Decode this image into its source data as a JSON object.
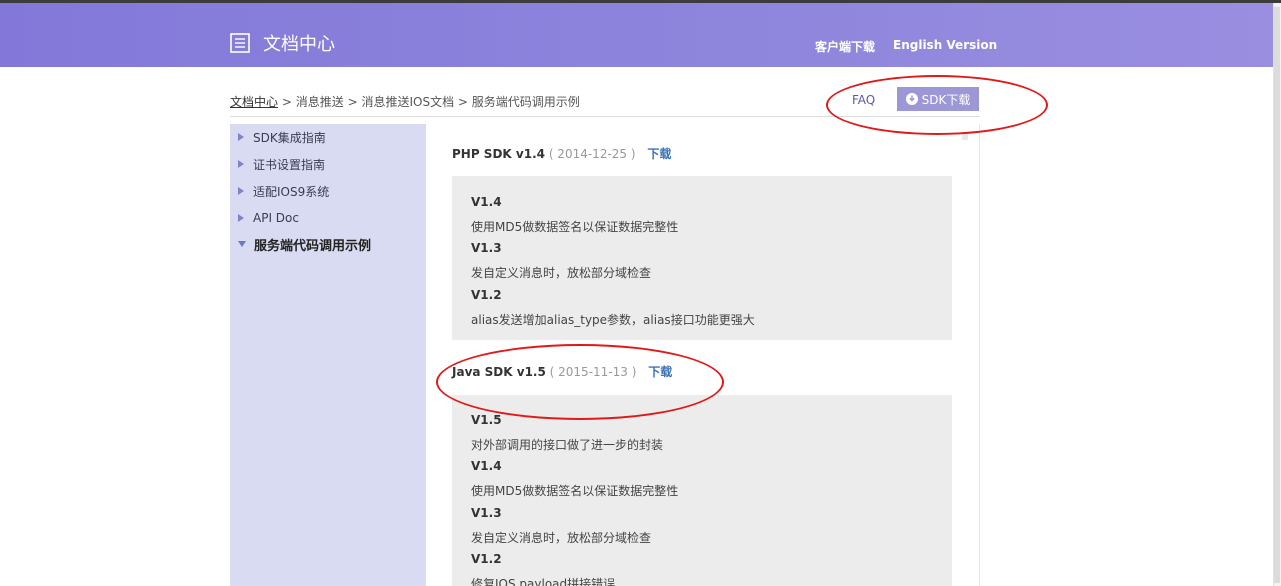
{
  "header": {
    "title": "文档中心",
    "logo_icon": "document-list-icon",
    "nav": {
      "client_download": "客户端下载",
      "english": "English Version"
    }
  },
  "breadcrumb": {
    "home": "文档中心",
    "separator": ">",
    "items": [
      "消息推送",
      "消息推送IOS文档",
      "服务端代码调用示例"
    ]
  },
  "actions": {
    "faq": "FAQ",
    "sdk_download": "SDK下载"
  },
  "sidebar": {
    "items": [
      {
        "label": "SDK集成指南"
      },
      {
        "label": "证书设置指南"
      },
      {
        "label": "适配IOS9系统"
      },
      {
        "label": "API Doc"
      },
      {
        "label": "服务端代码调用示例"
      }
    ]
  },
  "sdks": [
    {
      "name": "PHP SDK v1.4",
      "date": "( 2014-12-25 )",
      "download": "下载",
      "changelog": [
        {
          "version": "V1.4",
          "note": "使用MD5做数据签名以保证数据完整性"
        },
        {
          "version": "V1.3",
          "note": "发自定义消息时，放松部分域检查"
        },
        {
          "version": "V1.2",
          "note": "alias发送增加alias_type参数，alias接口功能更强大"
        }
      ]
    },
    {
      "name": "Java SDK v1.5",
      "date": "( 2015-11-13 )",
      "download": "下载",
      "changelog": [
        {
          "version": "V1.5",
          "note": "对外部调用的接口做了进一步的封装"
        },
        {
          "version": "V1.4",
          "note": "使用MD5做数据签名以保证数据完整性"
        },
        {
          "version": "V1.3",
          "note": "发自定义消息时，放松部分域检查"
        },
        {
          "version": "V1.2",
          "note": "修复IOS payload拼接错误"
        }
      ]
    }
  ],
  "colors": {
    "header_start": "#8378d9",
    "header_end": "#9a8ee0",
    "sidebar_bg": "#d8dbf1",
    "annotation_red": "#e01a1a",
    "link_blue": "#3d72b8"
  }
}
